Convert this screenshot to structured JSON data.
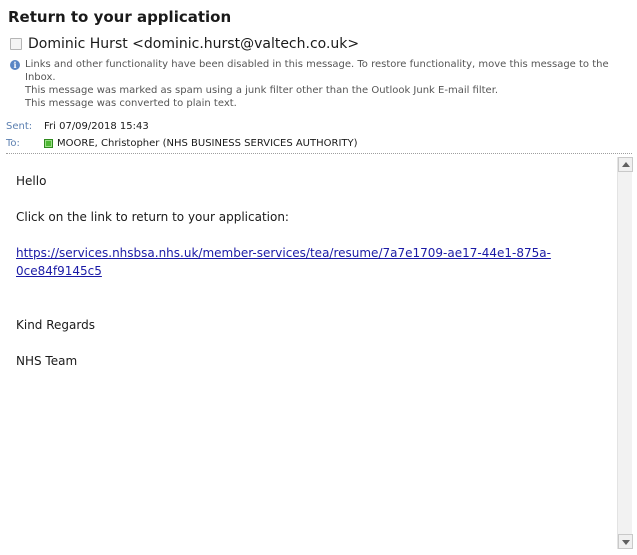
{
  "email": {
    "subject": "Return to your application",
    "sender": "Dominic Hurst <dominic.hurst@valtech.co.uk>",
    "info_lines": [
      "Links and other functionality have been disabled in this message. To restore functionality, move this message to the Inbox.",
      "This message was marked as spam using a junk filter other than the Outlook Junk E-mail filter.",
      "This message was converted to plain text."
    ],
    "sent_label": "Sent:",
    "sent_value": "Fri 07/09/2018 15:43",
    "to_label": "To:",
    "to_value": "MOORE, Christopher (NHS BUSINESS SERVICES AUTHORITY)",
    "presence_color": "#4fb834",
    "body": {
      "greeting": "Hello",
      "instruction": "Click on the link to return to your application:",
      "link_line1": "https://services.nhsbsa.nhs.uk/member-services/tea/resume/7a7e1709-ae17-44e1-875a-",
      "link_line2": "0ce84f9145c5",
      "signoff": "Kind Regards",
      "team": "NHS Team"
    }
  },
  "icons": {
    "info": "info-icon",
    "presence": "presence-status-icon",
    "scroll_up": "scroll-up-arrow-icon",
    "scroll_down": "scroll-down-arrow-icon"
  },
  "colors": {
    "label_blue": "#5b7fb0",
    "link": "#1a1aa6"
  }
}
